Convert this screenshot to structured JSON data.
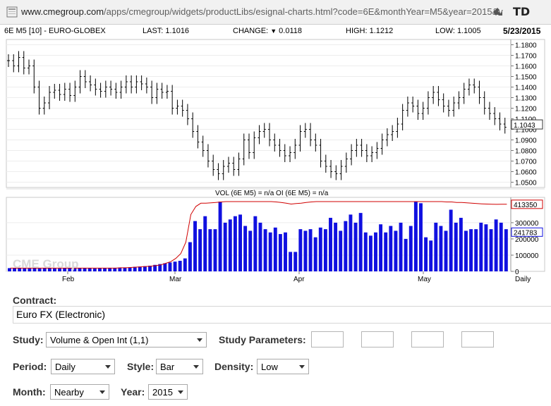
{
  "browser": {
    "url_host": "www.cmegroup.com",
    "url_path": "/apps/cmegroup/widgets/productLibs/esignal-charts.html?code=6E&monthYear=M5&year=2015&v",
    "extension_icons": [
      "puzzle-icon",
      "td-icon"
    ],
    "td_label": "TD"
  },
  "chart_header": {
    "symbol": "6E M5 [10] - EURO-GLOBEX",
    "last": "LAST: 1.1016",
    "change_label": "CHANGE:",
    "change_value": "0.0118",
    "high": "HIGH: 1.1212",
    "low": "LOW: 1.1005",
    "date": "5/23/2015"
  },
  "chart_data": [
    {
      "type": "ohlc",
      "title": "",
      "y_ticks": [
        "1.1800",
        "1.1700",
        "1.1600",
        "1.1500",
        "1.1400",
        "1.1300",
        "1.1200",
        "1.1100",
        "1.1000",
        "1.0900",
        "1.0800",
        "1.0700",
        "1.0600",
        "1.0500"
      ],
      "ylim": [
        1.045,
        1.185
      ],
      "last_price_label": "1.1043",
      "x_labels": [
        "Feb",
        "Mar",
        "Apr",
        "May"
      ],
      "period_label": "Daily",
      "series": [
        {
          "name": "",
          "close": [
            1.165,
            1.16,
            1.168,
            1.158,
            1.16,
            1.14,
            1.12,
            1.125,
            1.135,
            1.137,
            1.133,
            1.138,
            1.132,
            1.14,
            1.15,
            1.145,
            1.142,
            1.138,
            1.136,
            1.14,
            1.138,
            1.135,
            1.14,
            1.145,
            1.14,
            1.145,
            1.143,
            1.14,
            1.13,
            1.138,
            1.135,
            1.136,
            1.12,
            1.122,
            1.118,
            1.11,
            1.098,
            1.088,
            1.08,
            1.07,
            1.062,
            1.058,
            1.065,
            1.068,
            1.062,
            1.072,
            1.09,
            1.078,
            1.092,
            1.098,
            1.1,
            1.09,
            1.085,
            1.08,
            1.075,
            1.078,
            1.085,
            1.098,
            1.1,
            1.09,
            1.085,
            1.07,
            1.065,
            1.06,
            1.058,
            1.065,
            1.072,
            1.08,
            1.085,
            1.08,
            1.075,
            1.078,
            1.082,
            1.09,
            1.095,
            1.098,
            1.105,
            1.118,
            1.125,
            1.122,
            1.115,
            1.12,
            1.13,
            1.135,
            1.128,
            1.122,
            1.118,
            1.125,
            1.13,
            1.138,
            1.142,
            1.14,
            1.13,
            1.12,
            1.115,
            1.11,
            1.105,
            1.102
          ]
        }
      ]
    },
    {
      "type": "bar",
      "title": "VOL (6E M5) = n/a OI (6E M5) = n/a",
      "y_ticks": [
        "300000",
        "200000",
        "100000",
        "0"
      ],
      "ylim": [
        0,
        430000
      ],
      "watermark": "CME Group",
      "series": [
        {
          "name": "",
          "color": "#1010e0",
          "values": [
            20000,
            20000,
            20000,
            18000,
            18000,
            20000,
            18000,
            20000,
            20000,
            18000,
            18000,
            20000,
            20000,
            18000,
            20000,
            20000,
            20000,
            18000,
            20000,
            20000,
            22000,
            22000,
            24000,
            24000,
            25000,
            28000,
            30000,
            32000,
            35000,
            40000,
            45000,
            50000,
            55000,
            60000,
            65000,
            80000,
            180000,
            310000,
            260000,
            340000,
            260000,
            260000,
            440000,
            300000,
            320000,
            340000,
            350000,
            280000,
            250000,
            340000,
            300000,
            260000,
            240000,
            270000,
            230000,
            240000,
            120000,
            120000,
            260000,
            250000,
            260000,
            210000,
            270000,
            260000,
            330000,
            300000,
            250000,
            310000,
            350000,
            300000,
            360000,
            240000,
            220000,
            240000,
            290000,
            240000,
            280000,
            250000,
            300000,
            200000,
            280000,
            450000,
            420000,
            210000,
            190000,
            300000,
            280000,
            250000,
            380000,
            300000,
            330000,
            250000,
            260000,
            260000,
            300000,
            290000,
            260000,
            320000,
            300000,
            260000
          ]
        },
        {
          "name": "",
          "color": "#d00000",
          "label": "413350",
          "values": [
            20000,
            20000,
            20000,
            20000,
            20000,
            20000,
            20000,
            20000,
            20000,
            20000,
            20000,
            20000,
            20000,
            20000,
            20000,
            20000,
            20000,
            20000,
            20000,
            20000,
            20000,
            20000,
            22000,
            22000,
            24000,
            26000,
            28000,
            30000,
            32000,
            35000,
            40000,
            50000,
            60000,
            80000,
            110000,
            180000,
            350000,
            400000,
            420000,
            420000,
            422000,
            425000,
            428000,
            430000,
            432000,
            432000,
            433000,
            433000,
            433000,
            433000,
            433000,
            432000,
            430000,
            428000,
            425000,
            420000,
            415000,
            418000,
            420000,
            425000,
            428000,
            430000,
            430000,
            430000,
            430000,
            432000,
            432000,
            432000,
            432000,
            432000,
            432000,
            432000,
            432000,
            432000,
            432000,
            432000,
            432000,
            432000,
            432000,
            432000,
            432000,
            432000,
            432000,
            432000,
            432000,
            430000,
            430000,
            428000,
            428000,
            425000,
            425000,
            422000,
            420000,
            418000,
            416000,
            415000,
            414000,
            413000,
            413350,
            413350
          ]
        }
      ],
      "last_volume_label": "241783"
    }
  ],
  "form": {
    "contract_label": "Contract:",
    "contract_value": "Euro FX (Electronic)",
    "study_label": "Study:",
    "study_value": "Volume & Open Int (1,1)",
    "study_params_label": "Study Parameters:",
    "period_label": "Period:",
    "period_value": "Daily",
    "style_label": "Style:",
    "style_value": "Bar",
    "density_label": "Density:",
    "density_value": "Low",
    "month_label": "Month:",
    "month_value": "Nearby",
    "year_label": "Year:",
    "year_value": "2015"
  }
}
